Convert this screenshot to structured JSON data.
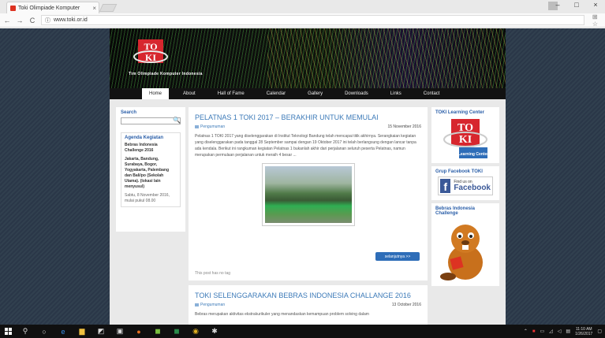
{
  "browser": {
    "tab_title": "Toki Olimpiade Komputer",
    "tab_close": "×",
    "url": "www.toki.or.id",
    "back": "←",
    "forward": "→",
    "reload": "C",
    "minimize": "–",
    "maximize": "□",
    "close": "×",
    "ext": "⊞ ☆"
  },
  "site": {
    "name": "Tim Olimpiade Komputer Indonesia",
    "logo_text_top": "TO",
    "logo_text_bottom": "KI"
  },
  "menu": [
    "Home",
    "About",
    "Hall of Fame",
    "Calendar",
    "Gallery",
    "Downloads",
    "Links",
    "Contact"
  ],
  "left_sidebar": {
    "search_label": "Search",
    "agenda_title": "Agenda Kegiatan",
    "agenda_event": "Bebras Indonesia Challenge 2016",
    "agenda_location": "Jakarta, Bandung, Surabaya, Bogor, Yogyakarta, Palembang dan Bali/po (Sekolah Utama). (lokasi lain menyusul)",
    "agenda_date": "Sabtu, 8 November 2016, mulai pukul 08.00"
  },
  "post1": {
    "title": "PELATNAS 1 TOKI 2017 – BERAKHIR UNTUK MEMULAI",
    "category": "Pengumuman",
    "date": "15 November 2016",
    "excerpt": "Pelatnas 1 TOKI 2017 yang diselenggarakan di Institut Teknologi Bandung telah mencapai titik akhirnya. Serangkaian kegiatan yang diselenggarakan pada tanggal 28 September sampai dengan 19 Oktober 2017 ini telah berlangsung dengan lancar tanpa ada kendala. Berikut ini rangkuman kegiatan Pelatnas 1 bukanlah akhir dari perjalanan seluruh peserta Pelatnas, namun merupakan permulaan perjalanan untuk meraih 4 besar ...",
    "readmore": "selanjutnya >>",
    "footer": "This post has no tag"
  },
  "post2": {
    "title": "TOKI SELENGGARAKAN BEBRAS INDONESIA CHALLANGE 2016",
    "category": "Pengumuman",
    "date": "13 October 2016",
    "excerpt": "Bebras merupakan aktivitas ekstrakurikuler yang menandaskan kemampuan problem solving dalam"
  },
  "right_sidebar": {
    "tlc_title": "TOKI Learning Center",
    "tlc_logo_text": "Learning Center",
    "fb_title": "Grup Facebook TOKI",
    "fb_findus": "Find us on",
    "fb_name": "Facebook",
    "bebras_title": "Bebras Indonesia Challenge"
  },
  "taskbar": {
    "clock_time": "11:10 AM",
    "clock_date": "1/26/2017"
  },
  "colors": {
    "link": "#3c7ab8",
    "button": "#2e6db8",
    "background": "#2a3748"
  }
}
